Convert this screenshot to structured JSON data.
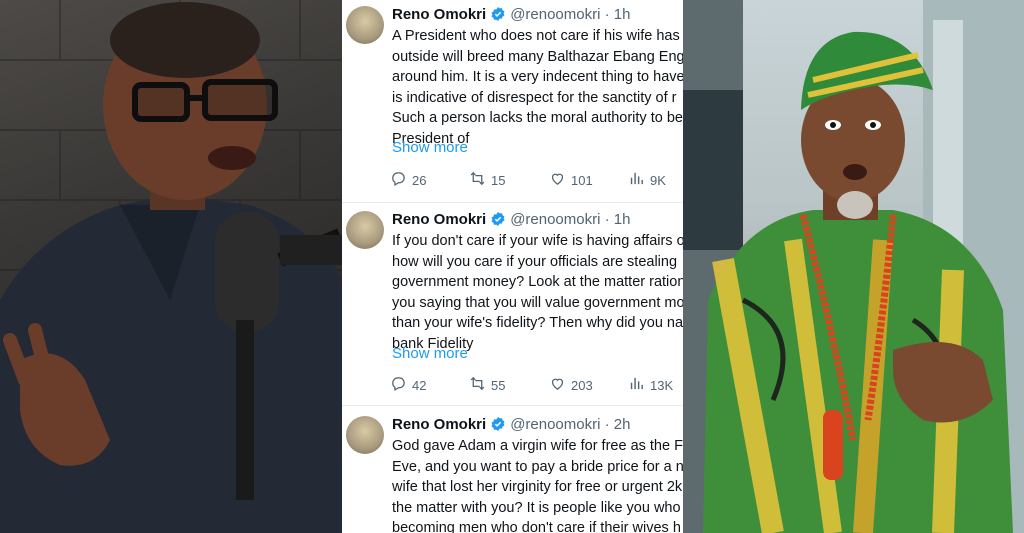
{
  "tweets": [
    {
      "name": "Reno Omokri",
      "handle": "@renoomokri",
      "time": "1h",
      "lines": [
        "A President who does not care if his wife has",
        "outside will breed many Balthazar Ebang Enge",
        "around him. It is a very indecent thing to have",
        "is indicative of disrespect for the sanctity of r",
        "Such a person lacks the moral authority to be",
        "President of"
      ],
      "show_more": "Show more",
      "replies": "26",
      "reposts": "15",
      "likes": "101",
      "views": "9K"
    },
    {
      "name": "Reno Omokri",
      "handle": "@renoomokri",
      "time": "1h",
      "lines": [
        "If you don't care if your wife is having affairs o",
        "how will you care if your officials are stealing",
        "government money? Look at the matter ration",
        "you saying that you will value government mo",
        "than your wife's fidelity? Then why did you na",
        "bank Fidelity"
      ],
      "show_more": "Show more",
      "replies": "42",
      "reposts": "55",
      "likes": "203",
      "views": "13K"
    },
    {
      "name": "Reno Omokri",
      "handle": "@renoomokri",
      "time": "2h",
      "lines": [
        "God gave Adam a virgin wife for free as the Fa",
        "Eve, and you want to pay a bride price for a no",
        "wife that lost her virginity for free or urgent 2k",
        "the matter with you? It is people like you who",
        "becoming men who don't care if their wives h"
      ]
    }
  ],
  "icons": {
    "verified": "verified-badge-icon",
    "reply": "reply-icon",
    "repost": "repost-icon",
    "like": "heart-icon",
    "views": "analytics-icon"
  },
  "colors": {
    "accent": "#1d9bf0",
    "text": "#0f1419",
    "muted": "#536471"
  }
}
